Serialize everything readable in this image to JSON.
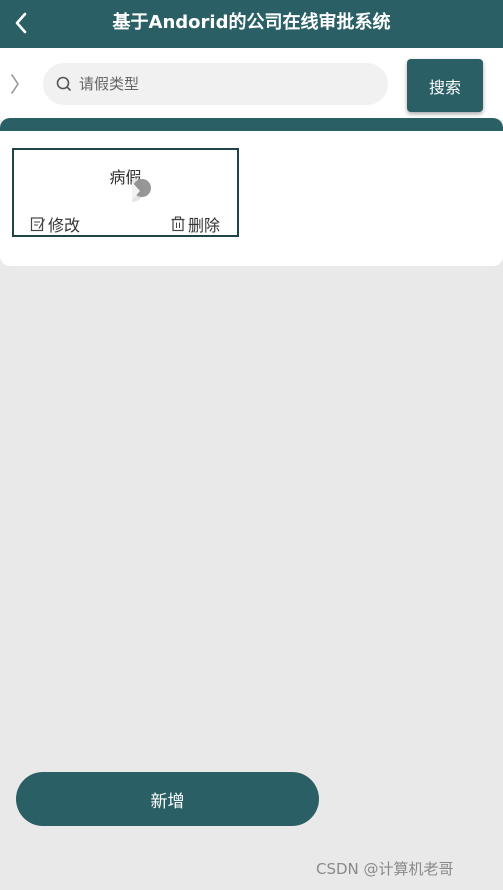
{
  "header": {
    "title": "基于Andorid的公司在线审批系统",
    "back_icon": "chevron-left-icon"
  },
  "search": {
    "placeholder": "请假类型",
    "value": "",
    "button_label": "搜索",
    "icon": "search-icon"
  },
  "list": {
    "items": [
      {
        "title": "病假",
        "edit_label": "修改",
        "delete_label": "删除"
      }
    ]
  },
  "footer": {
    "add_label": "新增"
  },
  "watermark": "CSDN @计算机老哥",
  "colors": {
    "primary": "#2a5f66",
    "background": "#e9e9e9",
    "card_border": "#1f4347"
  }
}
